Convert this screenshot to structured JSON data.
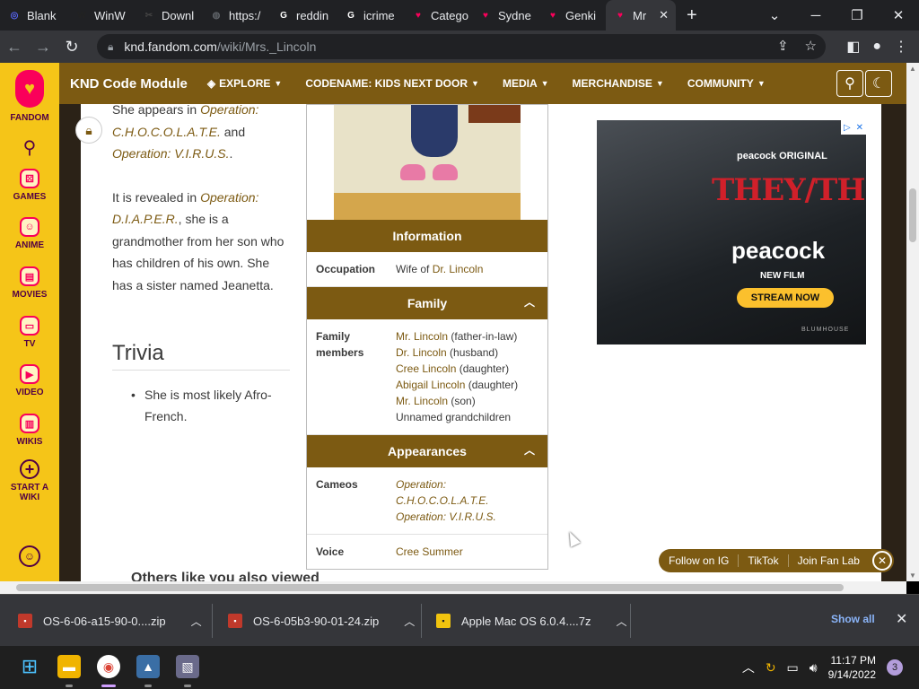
{
  "browser": {
    "tabs": [
      {
        "label": "Blank",
        "icon": "discord-icon",
        "color": "#5865f2",
        "glyph": "◎"
      },
      {
        "label": "WinW",
        "icon": "winworld-icon",
        "color": "#222222",
        "glyph": "W"
      },
      {
        "label": "Downl",
        "icon": "download-site-icon",
        "color": "#444444",
        "glyph": "✂"
      },
      {
        "label": "https:/",
        "icon": "globe-icon",
        "color": "#5f6368",
        "glyph": "◍"
      },
      {
        "label": "reddin",
        "icon": "google-icon",
        "color": "#ffffff",
        "glyph": "G"
      },
      {
        "label": "icrime",
        "icon": "google-icon",
        "color": "#ffffff",
        "glyph": "G"
      },
      {
        "label": "Catego",
        "icon": "fandom-icon",
        "color": "#fa005a",
        "glyph": "♥"
      },
      {
        "label": "Sydne",
        "icon": "fandom-icon",
        "color": "#fa005a",
        "glyph": "♥"
      },
      {
        "label": "Genki",
        "icon": "fandom-icon",
        "color": "#fa005a",
        "glyph": "♥"
      },
      {
        "label": "Mr",
        "icon": "fandom-icon",
        "color": "#fa005a",
        "glyph": "♥",
        "active": true
      }
    ],
    "new_tab": "+",
    "url_domain": "knd.fandom.com",
    "url_path": "/wiki/Mrs._Lincoln"
  },
  "fandom_rail": {
    "brand": "FANDOM",
    "items": [
      {
        "label": "GAMES",
        "icon": "games-icon",
        "glyph": "⚄"
      },
      {
        "label": "ANIME",
        "icon": "anime-icon",
        "glyph": "☺"
      },
      {
        "label": "MOVIES",
        "icon": "movies-icon",
        "glyph": "▤"
      },
      {
        "label": "TV",
        "icon": "tv-icon",
        "glyph": "▭"
      },
      {
        "label": "VIDEO",
        "icon": "video-icon",
        "glyph": "▶"
      },
      {
        "label": "WIKIS",
        "icon": "wikis-icon",
        "glyph": "▥"
      }
    ],
    "start_wiki_line1": "START A",
    "start_wiki_line2": "WIKI"
  },
  "wiki_header": {
    "name": "KND Code Module",
    "menus": [
      "EXPLORE",
      "CODENAME: KIDS NEXT DOOR",
      "MEDIA",
      "MERCHANDISE",
      "COMMUNITY"
    ]
  },
  "article": {
    "p1_pre": "She appears in ",
    "p1_link1": "Operation: C.H.O.C.O.L.A.T.E.",
    "p1_mid": " and ",
    "p1_link2": "Operation: V.I.R.U.S.",
    "p1_post": ".",
    "p2_pre": "It is revealed in ",
    "p2_link": "Operation: D.I.A.P.E.R.",
    "p2_post": ", she is a grandmother from her son who has children of his own. She has a sister named Jeanetta.",
    "trivia_heading": "Trivia",
    "trivia_items": [
      "She is most likely Afro-French."
    ],
    "others_heading": "Others like you also viewed"
  },
  "infobox": {
    "info_heading": "Information",
    "occupation_label": "Occupation",
    "occupation_pre": "Wife of ",
    "occupation_link": "Dr. Lincoln",
    "family_heading": "Family",
    "family_label": "Family members",
    "family_members": [
      {
        "name": "Mr. Lincoln",
        "rel": " (father-in-law)",
        "link": true
      },
      {
        "name": "Dr. Lincoln",
        "rel": " (husband)",
        "link": true
      },
      {
        "name": "Cree Lincoln",
        "rel": " (daughter)",
        "link": true
      },
      {
        "name": "Abigail Lincoln",
        "rel": " (daughter)",
        "link": true
      },
      {
        "name": "Mr. Lincoln",
        "rel": " (son)",
        "link": true
      },
      {
        "name": "Unnamed grandchildren",
        "rel": "",
        "link": false
      }
    ],
    "appearances_heading": "Appearances",
    "cameos_label": "Cameos",
    "cameos": [
      "Operation: C.H.O.C.O.L.A.T.E.",
      "Operation: V.I.R.U.S."
    ],
    "voice_label": "Voice",
    "voice_value": "Cree Summer"
  },
  "ad": {
    "top": "peacock ORIGINAL",
    "title": "THEY/THEM",
    "brand": "peacock",
    "sub": "NEW FILM",
    "cta": "STREAM NOW",
    "logo": "BLUMHOUSE"
  },
  "social_pill": [
    "Follow on IG",
    "TikTok",
    "Join Fan Lab"
  ],
  "downloads": [
    {
      "name": "OS-6-06-a15-90-0....zip",
      "icon": "zip-icon"
    },
    {
      "name": "OS-6-05b3-90-01-24.zip",
      "icon": "zip-icon"
    },
    {
      "name": "Apple Mac OS 6.0.4....7z",
      "icon": "archive-icon"
    }
  ],
  "show_all": "Show all",
  "taskbar": {
    "time": "11:17 PM",
    "date": "9/14/2022",
    "notifications": "3"
  },
  "colors": {
    "fandom_yellow": "#f5c518",
    "wiki_brown": "#7c5a12",
    "fandom_pink": "#fa005a"
  }
}
